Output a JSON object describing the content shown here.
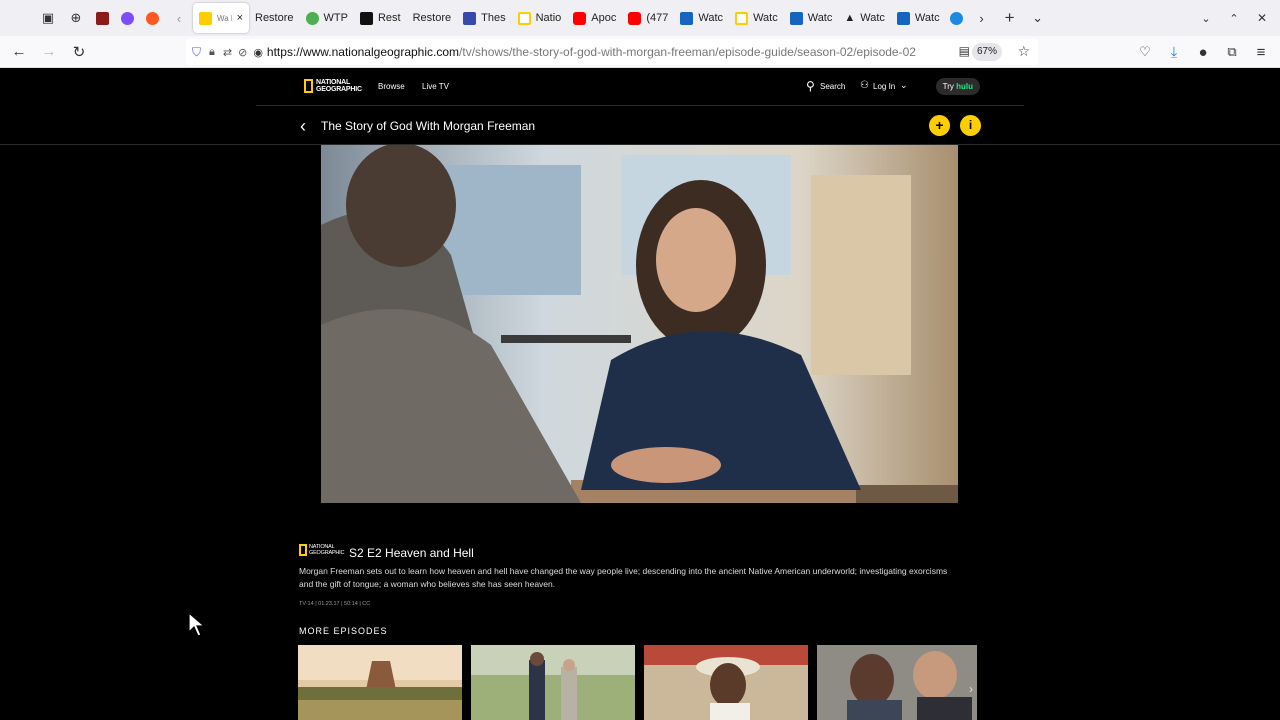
{
  "browser": {
    "tabs": [
      {
        "label": "",
        "favicon": "#1e88e5"
      },
      {
        "label": "",
        "favicon": "#8b1a1a"
      },
      {
        "label": "",
        "favicon": "#7c4dff"
      },
      {
        "label": "",
        "favicon": "#ff5722"
      },
      {
        "label": "Wa PL",
        "favicon": "#ffce00"
      },
      {
        "label": "Restore",
        "favicon": ""
      },
      {
        "label": "WTP",
        "favicon": "#4caf50"
      },
      {
        "label": "Rest",
        "favicon": "#111111"
      },
      {
        "label": "Restore",
        "favicon": ""
      },
      {
        "label": "Thes",
        "favicon": "#3949ab"
      },
      {
        "label": "Natio",
        "favicon": "#ffce00"
      },
      {
        "label": "Apoc",
        "favicon": "#ff0000"
      },
      {
        "label": "(477",
        "favicon": "#ff0000"
      },
      {
        "label": "Watc",
        "favicon": "#1565c0"
      },
      {
        "label": "Watc",
        "favicon": "#ffce00"
      },
      {
        "label": "Watc",
        "favicon": "#1565c0"
      },
      {
        "label": "Watc",
        "favicon": "#222222"
      },
      {
        "label": "Watc",
        "favicon": "#1565c0"
      }
    ],
    "url_host": "https://www.nationalgeographic.com",
    "url_path": "/tv/shows/the-story-of-god-with-morgan-freeman/episode-guide/season-02/episode-02",
    "zoom": "67%"
  },
  "site": {
    "logo_line1": "NATIONAL",
    "logo_line2": "GEOGRAPHIC",
    "nav": {
      "browse": "Browse",
      "live_tv": "Live TV"
    },
    "search": "Search",
    "login": "Log In",
    "try": "Try",
    "hulu": "hulu"
  },
  "show": {
    "title": "The Story of God With Morgan Freeman",
    "add_icon": "+",
    "info_icon": "i"
  },
  "episode": {
    "title": "S2 E2 Heaven and Hell",
    "description": "Morgan Freeman sets out to learn how heaven and hell have changed the way people live; descending into the ancient Native American underworld; investigating exorcisms and the gift of tongue; a woman who believes she has seen heaven.",
    "meta": "TV-14 | 01.23.17 | 50:14 | CC"
  },
  "more_episodes": {
    "label": "MORE EPISODES"
  },
  "colors": {
    "accent": "#ffce00",
    "hulu": "#1ce783"
  }
}
